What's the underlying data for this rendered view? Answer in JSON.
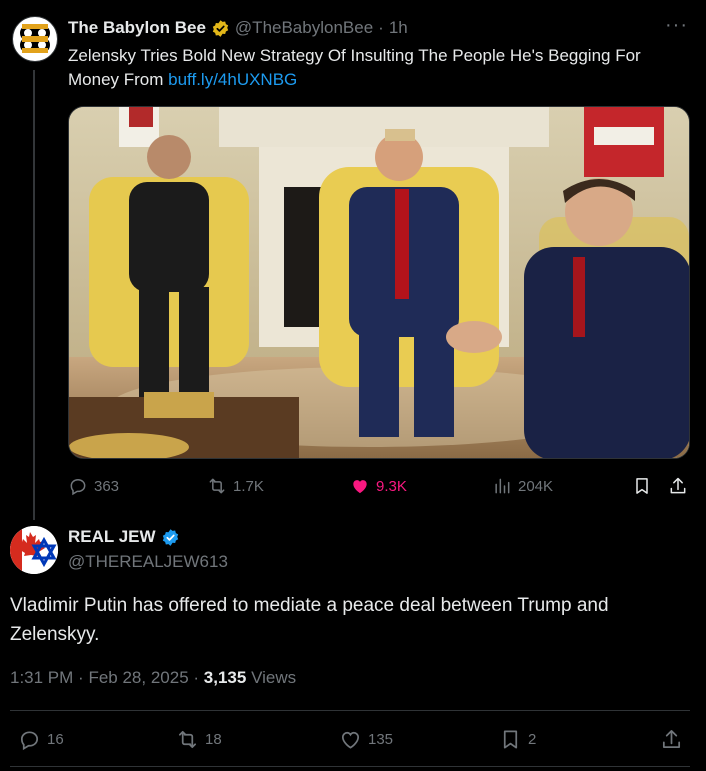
{
  "quoted": {
    "name": "The Babylon Bee",
    "handle": "@TheBabylonBee",
    "separator": "·",
    "time": "1h",
    "more": "···",
    "text": "Zelensky Tries Bold New Strategy Of Insulting The People He's Begging For Money From ",
    "link": "buff.ly/4hUXNBG",
    "stats": {
      "replies": "363",
      "reposts": "1.7K",
      "likes": "9.3K",
      "views": "204K"
    }
  },
  "post": {
    "name": "REAL JEW",
    "handle": "@THEREALJEW613",
    "text": "Vladimir Putin has offered to mediate a peace deal between Trump and Zelenskyy.",
    "time": "1:31 PM",
    "date": "Feb 28, 2025",
    "dot": "·",
    "views_count": "3,135",
    "views_label": "Views",
    "stats": {
      "replies": "16",
      "reposts": "18",
      "likes": "135",
      "bookmarks": "2"
    }
  },
  "colors": {
    "background": "#000000",
    "link": "#1d9bf0",
    "like_active": "#f91880",
    "muted": "#71767b",
    "verified_gold": "#e2b719",
    "verified_blue": "#1d9bf0"
  },
  "icons": [
    "reply-icon",
    "repost-icon",
    "heart-icon",
    "views-icon",
    "bookmark-icon",
    "share-icon",
    "more-icon",
    "verified-badge-icon"
  ]
}
